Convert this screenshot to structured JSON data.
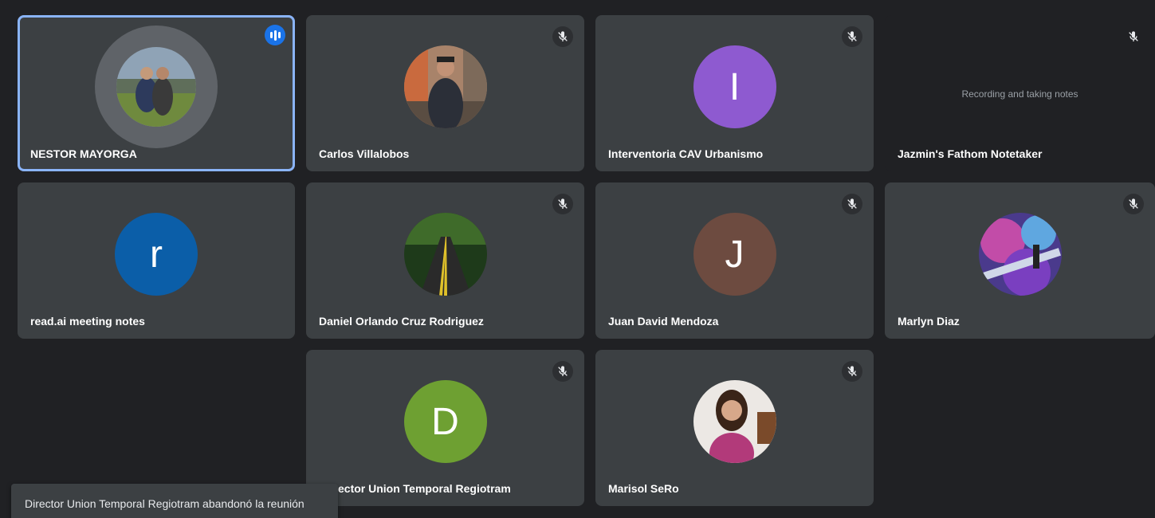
{
  "participants": [
    {
      "name": "NESTOR MAYORGA",
      "status": "speaking"
    },
    {
      "name": "Carlos Villalobos",
      "status": "muted"
    },
    {
      "name": "Interventoria CAV Urbanismo",
      "initial": "I",
      "status": "muted",
      "avatar_color": "#8e5ad0"
    },
    {
      "name": "Jazmin's Fathom Notetaker",
      "status": "muted",
      "tile_text": "Recording and taking notes"
    },
    {
      "name": "read.ai meeting notes",
      "initial": "r",
      "avatar_color": "#0b5ea8"
    },
    {
      "name": "Daniel Orlando Cruz Rodriguez",
      "status": "muted"
    },
    {
      "name": "Juan David Mendoza",
      "initial": "J",
      "status": "muted",
      "avatar_color": "#6d4b40"
    },
    {
      "name": "Marlyn Diaz",
      "status": "muted"
    },
    {
      "name": "ector Union Temporal Regiotram",
      "initial": "D",
      "status": "muted",
      "avatar_color": "#6ea032"
    },
    {
      "name": "Marisol SeRo",
      "status": "muted"
    }
  ],
  "notification": {
    "text": "Director Union Temporal Regiotram abandonó la reunión"
  },
  "colors": {
    "background": "#202124",
    "tile": "#3c4043",
    "active_border": "#8ab4f8",
    "speaking_badge": "#1a73e8"
  }
}
